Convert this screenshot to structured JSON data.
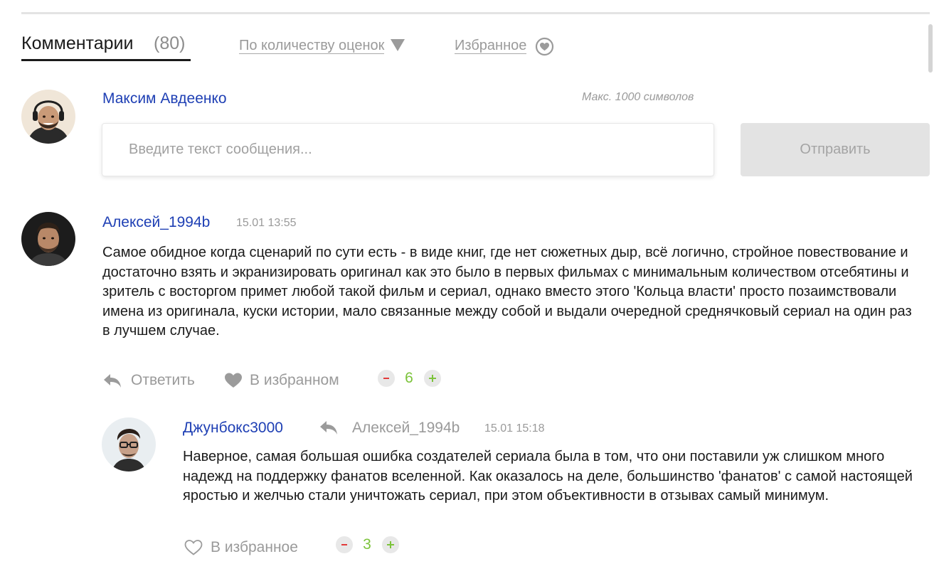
{
  "header": {
    "tab_label": "Комментарии",
    "tab_count": "(80)",
    "sort_label": "По количеству оценок",
    "favorites_label": "Избранное"
  },
  "composer": {
    "user_name": "Максим Авдеенко",
    "max_hint": "Макс. 1000 символов",
    "placeholder": "Введите текст сообщения...",
    "submit_label": "Отправить"
  },
  "comments": [
    {
      "author": "Алексей_1994b",
      "time": "15.01 13:55",
      "text": "Самое обидное когда сценарий по сути есть - в виде книг, где нет сюжетных дыр, всё логично, стройное повествование и достаточно взять и экранизировать оригинал как это было в первых фильмах с минимальным количеством отсебятины и зритель с восторгом примет любой такой фильм и сериал, однако вместо этого 'Кольца власти' просто позаимствовали имена из оригинала, куски истории, мало связанные между собой и выдали очередной среднячковый сериал на один раз в лучшем случае.",
      "reply_label": "Ответить",
      "favorite_label": "В избранном",
      "favorited": true,
      "score": "6"
    },
    {
      "author": "Джунбокс3000",
      "reply_to": "Алексей_1994b",
      "time": "15.01 15:18",
      "text": "Наверное, самая большая ошибка создателей сериала была в том, что они поставили уж слишком много надежд на поддержку фанатов вселенной. Как оказалось на деле, большинство 'фанатов' с самой настоящей яростью и желчью стали уничтожать сериал, при этом объективности в отзывах самый минимум.",
      "favorite_label": "В избранное",
      "favorited": false,
      "score": "3"
    }
  ],
  "colors": {
    "link_name": "#1e3fb4",
    "muted": "#9a9a9a",
    "score_positive": "#7cc33b",
    "vote_minus": "#e23a3a"
  }
}
